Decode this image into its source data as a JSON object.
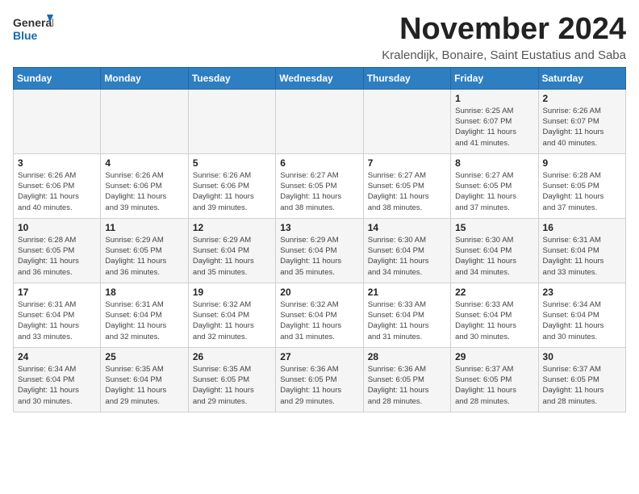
{
  "header": {
    "logo_general": "General",
    "logo_blue": "Blue",
    "month_title": "November 2024",
    "subtitle": "Kralendijk, Bonaire, Saint Eustatius and Saba"
  },
  "weekdays": [
    "Sunday",
    "Monday",
    "Tuesday",
    "Wednesday",
    "Thursday",
    "Friday",
    "Saturday"
  ],
  "weeks": [
    {
      "days": [
        {
          "num": "",
          "info": ""
        },
        {
          "num": "",
          "info": ""
        },
        {
          "num": "",
          "info": ""
        },
        {
          "num": "",
          "info": ""
        },
        {
          "num": "",
          "info": ""
        },
        {
          "num": "1",
          "info": "Sunrise: 6:25 AM\nSunset: 6:07 PM\nDaylight: 11 hours\nand 41 minutes."
        },
        {
          "num": "2",
          "info": "Sunrise: 6:26 AM\nSunset: 6:07 PM\nDaylight: 11 hours\nand 40 minutes."
        }
      ]
    },
    {
      "days": [
        {
          "num": "3",
          "info": "Sunrise: 6:26 AM\nSunset: 6:06 PM\nDaylight: 11 hours\nand 40 minutes."
        },
        {
          "num": "4",
          "info": "Sunrise: 6:26 AM\nSunset: 6:06 PM\nDaylight: 11 hours\nand 39 minutes."
        },
        {
          "num": "5",
          "info": "Sunrise: 6:26 AM\nSunset: 6:06 PM\nDaylight: 11 hours\nand 39 minutes."
        },
        {
          "num": "6",
          "info": "Sunrise: 6:27 AM\nSunset: 6:05 PM\nDaylight: 11 hours\nand 38 minutes."
        },
        {
          "num": "7",
          "info": "Sunrise: 6:27 AM\nSunset: 6:05 PM\nDaylight: 11 hours\nand 38 minutes."
        },
        {
          "num": "8",
          "info": "Sunrise: 6:27 AM\nSunset: 6:05 PM\nDaylight: 11 hours\nand 37 minutes."
        },
        {
          "num": "9",
          "info": "Sunrise: 6:28 AM\nSunset: 6:05 PM\nDaylight: 11 hours\nand 37 minutes."
        }
      ]
    },
    {
      "days": [
        {
          "num": "10",
          "info": "Sunrise: 6:28 AM\nSunset: 6:05 PM\nDaylight: 11 hours\nand 36 minutes."
        },
        {
          "num": "11",
          "info": "Sunrise: 6:29 AM\nSunset: 6:05 PM\nDaylight: 11 hours\nand 36 minutes."
        },
        {
          "num": "12",
          "info": "Sunrise: 6:29 AM\nSunset: 6:04 PM\nDaylight: 11 hours\nand 35 minutes."
        },
        {
          "num": "13",
          "info": "Sunrise: 6:29 AM\nSunset: 6:04 PM\nDaylight: 11 hours\nand 35 minutes."
        },
        {
          "num": "14",
          "info": "Sunrise: 6:30 AM\nSunset: 6:04 PM\nDaylight: 11 hours\nand 34 minutes."
        },
        {
          "num": "15",
          "info": "Sunrise: 6:30 AM\nSunset: 6:04 PM\nDaylight: 11 hours\nand 34 minutes."
        },
        {
          "num": "16",
          "info": "Sunrise: 6:31 AM\nSunset: 6:04 PM\nDaylight: 11 hours\nand 33 minutes."
        }
      ]
    },
    {
      "days": [
        {
          "num": "17",
          "info": "Sunrise: 6:31 AM\nSunset: 6:04 PM\nDaylight: 11 hours\nand 33 minutes."
        },
        {
          "num": "18",
          "info": "Sunrise: 6:31 AM\nSunset: 6:04 PM\nDaylight: 11 hours\nand 32 minutes."
        },
        {
          "num": "19",
          "info": "Sunrise: 6:32 AM\nSunset: 6:04 PM\nDaylight: 11 hours\nand 32 minutes."
        },
        {
          "num": "20",
          "info": "Sunrise: 6:32 AM\nSunset: 6:04 PM\nDaylight: 11 hours\nand 31 minutes."
        },
        {
          "num": "21",
          "info": "Sunrise: 6:33 AM\nSunset: 6:04 PM\nDaylight: 11 hours\nand 31 minutes."
        },
        {
          "num": "22",
          "info": "Sunrise: 6:33 AM\nSunset: 6:04 PM\nDaylight: 11 hours\nand 30 minutes."
        },
        {
          "num": "23",
          "info": "Sunrise: 6:34 AM\nSunset: 6:04 PM\nDaylight: 11 hours\nand 30 minutes."
        }
      ]
    },
    {
      "days": [
        {
          "num": "24",
          "info": "Sunrise: 6:34 AM\nSunset: 6:04 PM\nDaylight: 11 hours\nand 30 minutes."
        },
        {
          "num": "25",
          "info": "Sunrise: 6:35 AM\nSunset: 6:04 PM\nDaylight: 11 hours\nand 29 minutes."
        },
        {
          "num": "26",
          "info": "Sunrise: 6:35 AM\nSunset: 6:05 PM\nDaylight: 11 hours\nand 29 minutes."
        },
        {
          "num": "27",
          "info": "Sunrise: 6:36 AM\nSunset: 6:05 PM\nDaylight: 11 hours\nand 29 minutes."
        },
        {
          "num": "28",
          "info": "Sunrise: 6:36 AM\nSunset: 6:05 PM\nDaylight: 11 hours\nand 28 minutes."
        },
        {
          "num": "29",
          "info": "Sunrise: 6:37 AM\nSunset: 6:05 PM\nDaylight: 11 hours\nand 28 minutes."
        },
        {
          "num": "30",
          "info": "Sunrise: 6:37 AM\nSunset: 6:05 PM\nDaylight: 11 hours\nand 28 minutes."
        }
      ]
    }
  ]
}
